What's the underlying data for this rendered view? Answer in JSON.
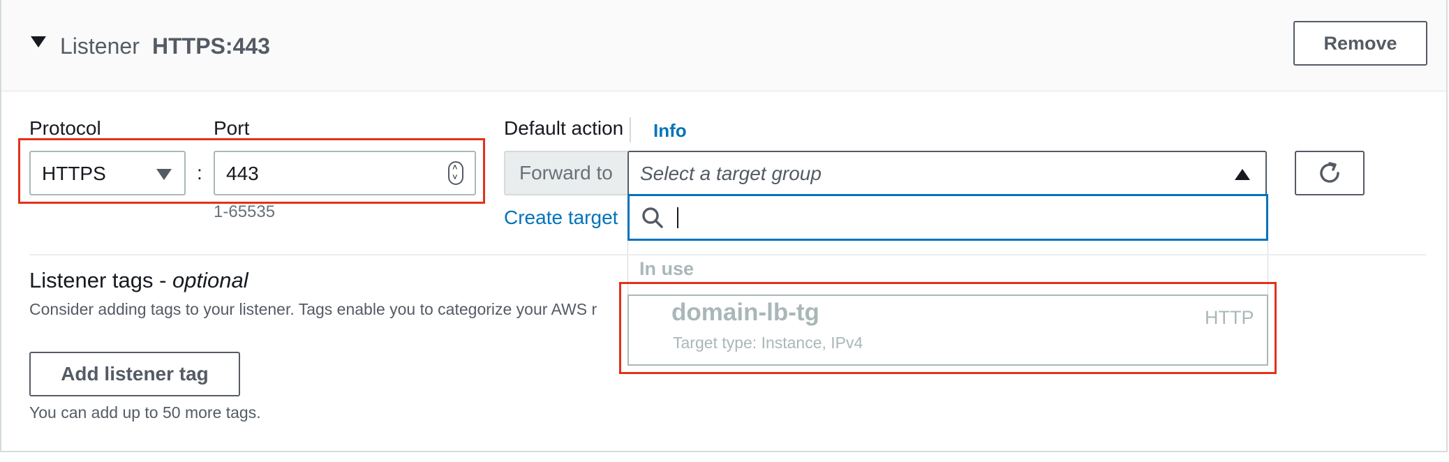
{
  "header": {
    "title": "Listener",
    "listener_name": "HTTPS:443",
    "remove_label": "Remove"
  },
  "protocol": {
    "label": "Protocol",
    "value": "HTTPS"
  },
  "port": {
    "label": "Port",
    "value": "443",
    "hint": "1-65535"
  },
  "default_action": {
    "label": "Default action",
    "info_label": "Info",
    "forward_label": "Forward to",
    "target_placeholder": "Select a target group",
    "create_link": "Create target",
    "search_value": "",
    "group_label": "In use",
    "options": [
      {
        "name": "domain-lb-tg",
        "description": "Target type: Instance, IPv4",
        "protocol": "HTTP"
      }
    ]
  },
  "listener_tags": {
    "title": "Listener tags - ",
    "title_suffix": "optional",
    "description": "Consider adding tags to your listener. Tags enable you to categorize your AWS r",
    "add_button": "Add listener tag",
    "hint": "You can add up to 50 more tags."
  },
  "colors": {
    "link": "#0073bb",
    "highlight": "#e3311a",
    "focus": "#0073bb"
  }
}
